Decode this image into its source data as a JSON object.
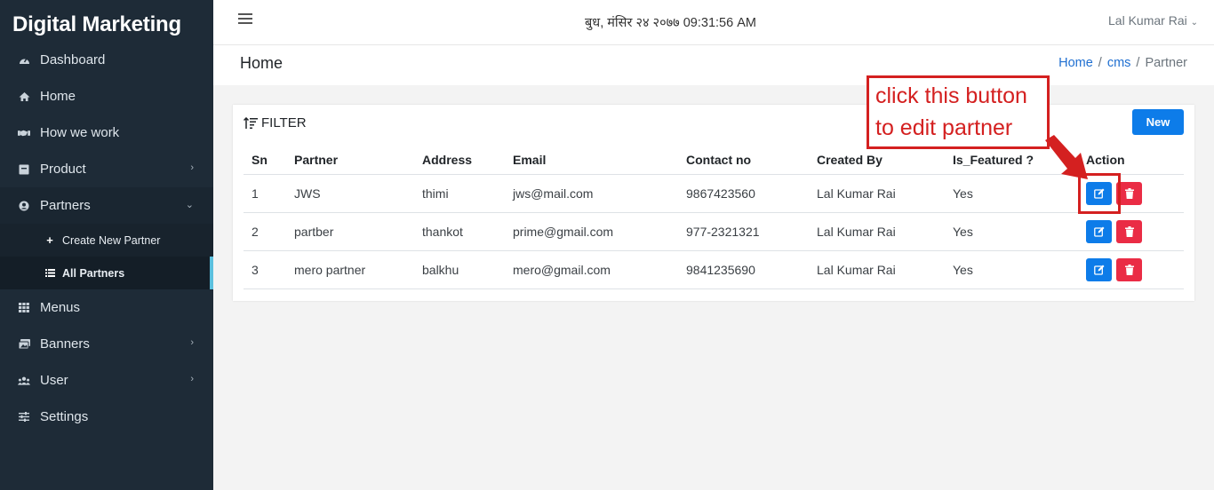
{
  "sidebar": {
    "brand": "Digital Marketing",
    "items": [
      {
        "label": "Dashboard",
        "icon": "dashboard-icon"
      },
      {
        "label": "Home",
        "icon": "home-icon"
      },
      {
        "label": "How we work",
        "icon": "handshake-icon"
      },
      {
        "label": "Product",
        "icon": "box-icon"
      },
      {
        "label": "Partners",
        "icon": "user-circle-icon"
      },
      {
        "label": "Menus",
        "icon": "grid-icon"
      },
      {
        "label": "Banners",
        "icon": "images-icon"
      },
      {
        "label": "User",
        "icon": "users-icon"
      },
      {
        "label": "Settings",
        "icon": "sliders-icon"
      }
    ],
    "subitems": [
      {
        "label": "Create New Partner",
        "icon": "plus-icon"
      },
      {
        "label": "All Partners",
        "icon": "list-icon"
      }
    ]
  },
  "header": {
    "datetime": "बुध, मंसिर २४ २०७७ 09:31:56 AM",
    "user": "Lal Kumar Rai"
  },
  "titlebar": {
    "title": "Home",
    "breadcrumb": [
      "Home",
      "cms",
      "Partner"
    ]
  },
  "card": {
    "filter_label": "FILTER",
    "new_label": "New",
    "columns": [
      "Sn",
      "Partner",
      "Address",
      "Email",
      "Contact no",
      "Created By",
      "Is_Featured ?",
      "Action"
    ],
    "rows": [
      {
        "sn": "1",
        "partner": "JWS",
        "address": "thimi",
        "email": "jws@mail.com",
        "contact": "9867423560",
        "created_by": "Lal Kumar Rai",
        "featured": "Yes"
      },
      {
        "sn": "2",
        "partner": "partber",
        "address": "thankot",
        "email": "prime@gmail.com",
        "contact": "977-2321321",
        "created_by": "Lal Kumar Rai",
        "featured": "Yes"
      },
      {
        "sn": "3",
        "partner": "mero partner",
        "address": "balkhu",
        "email": "mero@gmail.com",
        "contact": "9841235690",
        "created_by": "Lal Kumar Rai",
        "featured": "Yes"
      }
    ]
  },
  "annotation": {
    "line1": "click this button",
    "line2": "to edit partner"
  },
  "colors": {
    "sidebar_bg": "#1e2b37",
    "primary": "#0d7ce9",
    "danger": "#ea2c45",
    "annotation": "#d42020",
    "active_indicator": "#5bc0de"
  }
}
